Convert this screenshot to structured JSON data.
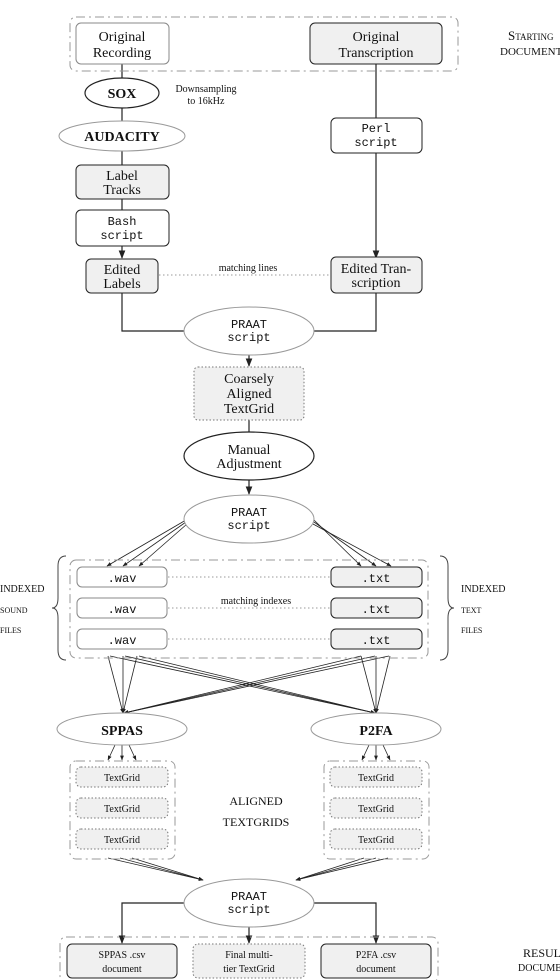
{
  "diagram": {
    "starting_docs_label": [
      "Starting",
      "documents"
    ],
    "result_docs_label": [
      "Resulting",
      "documents"
    ],
    "original_recording": [
      "Original",
      "Recording"
    ],
    "original_transcription": [
      "Original",
      "Transcription"
    ],
    "sox": "SOX",
    "downsampling_note": [
      "Downsampling",
      "to 16kHz"
    ],
    "audacity": "AUDACITY",
    "perl_script": [
      "Perl",
      "script"
    ],
    "label_tracks": [
      "Label",
      "Tracks"
    ],
    "bash_script": [
      "Bash",
      "script"
    ],
    "edited_labels": [
      "Edited",
      "Labels"
    ],
    "edited_transcription": [
      "Edited Tran-",
      "scription"
    ],
    "matching_lines": "matching lines",
    "praat_script_1": [
      "PRAAT",
      "script"
    ],
    "coarsely_aligned": [
      "Coarsely",
      "Aligned",
      "TextGrid"
    ],
    "manual_adjustment": [
      "Manual",
      "Adjustment"
    ],
    "praat_script_2": [
      "PRAAT",
      "script"
    ],
    "indexed_sound_files": [
      "Indexed",
      "sound",
      "files"
    ],
    "indexed_text_files": [
      "Indexed",
      "text",
      "files"
    ],
    "wav_files": [
      ".wav",
      ".wav",
      ".wav"
    ],
    "txt_files": [
      ".txt",
      ".txt",
      ".txt"
    ],
    "matching_indexes": "matching indexes",
    "sppas": "SPPAS",
    "p2fa": "P2FA",
    "sppas_textgrids": [
      "TextGrid",
      "TextGrid",
      "TextGrid"
    ],
    "p2fa_textgrids": [
      "TextGrid",
      "TextGrid",
      "TextGrid"
    ],
    "aligned_textgrids_label": [
      "Aligned",
      "TextGrids"
    ],
    "praat_script_3": [
      "PRAAT",
      "script"
    ],
    "sppas_csv": [
      "SPPAS .csv",
      "document"
    ],
    "final_textgrid": [
      "Final multi-",
      "tier TextGrid"
    ],
    "p2fa_csv": [
      "P2FA .csv",
      "document"
    ]
  }
}
